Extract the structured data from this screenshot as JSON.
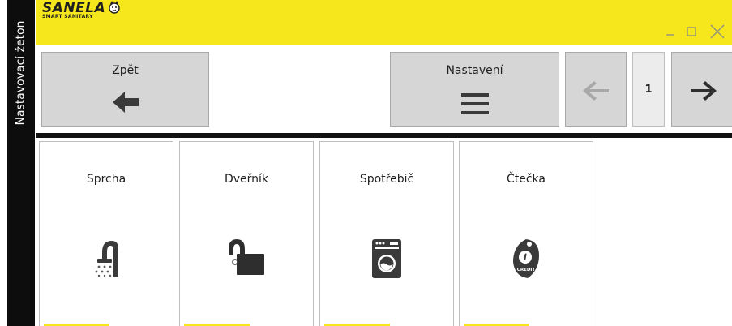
{
  "side_title": "Nastavovací žeton",
  "brand": {
    "name": "SANELA",
    "tagline": "SMART SANITARY",
    "accent_color": "#f6e71d"
  },
  "window_controls": {
    "minimize_icon": "minimize-icon",
    "maximize_icon": "maximize-icon",
    "close_icon": "close-icon"
  },
  "toolbar": {
    "back_label": "Zpět",
    "back_icon": "arrow-left-icon",
    "settings_label": "Nastavení",
    "settings_icon": "menu-icon",
    "prev_icon": "arrow-left-icon",
    "page_number": "1",
    "next_icon": "arrow-right-icon"
  },
  "tiles": [
    {
      "label": "Sprcha",
      "icon": "shower-icon"
    },
    {
      "label": "Dveřník",
      "icon": "unlock-icon"
    },
    {
      "label": "Spotřebič",
      "icon": "washing-machine-icon"
    },
    {
      "label": "Čtečka",
      "icon": "credit-tag-icon"
    }
  ],
  "tile_icon_texts": {
    "credit": "CREDIT"
  }
}
